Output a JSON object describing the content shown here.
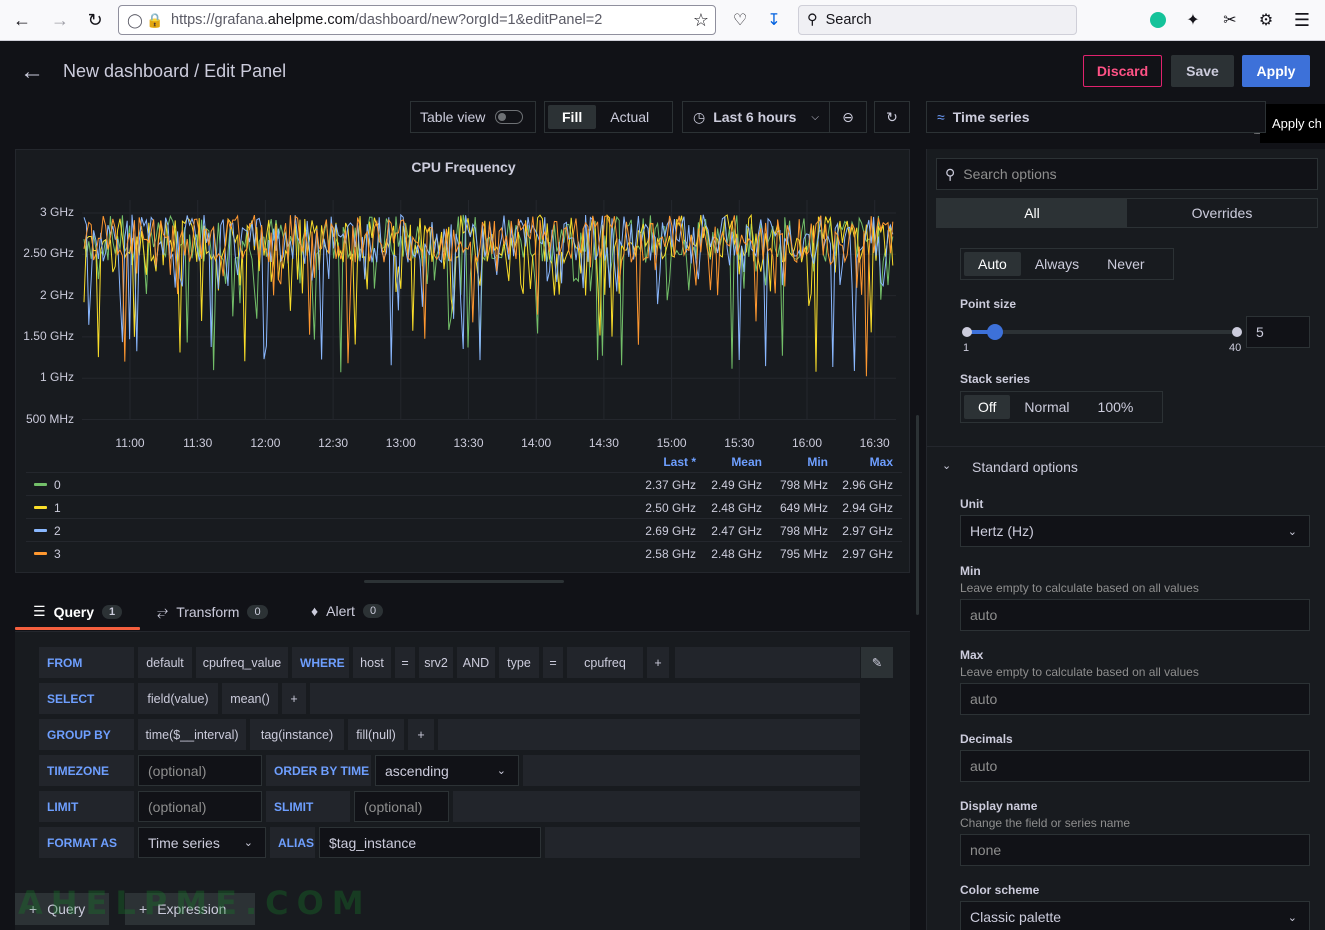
{
  "browser": {
    "url_prefix": "https://grafana.",
    "url_domain": "ahelpme.com",
    "url_rest": "/dashboard/new?orgId=1&editPanel=2",
    "search_placeholder": "Search"
  },
  "header": {
    "title": "New dashboard / Edit Panel",
    "discard": "Discard",
    "save": "Save",
    "apply": "Apply",
    "tooltip": "Apply ch"
  },
  "toolbar": {
    "table_view": "Table view",
    "fill": "Fill",
    "actual": "Actual",
    "time_range": "Last 6 hours"
  },
  "panel": {
    "title": "CPU Frequency",
    "y_ticks": [
      "3 GHz",
      "2.50 GHz",
      "2 GHz",
      "1.50 GHz",
      "1 GHz",
      "500 MHz"
    ],
    "x_ticks": [
      "11:00",
      "11:30",
      "12:00",
      "12:30",
      "13:00",
      "13:30",
      "14:00",
      "14:30",
      "15:00",
      "15:30",
      "16:00",
      "16:30"
    ],
    "legend_headers": [
      "Last *",
      "Mean",
      "Min",
      "Max"
    ],
    "legend": [
      {
        "name": "0",
        "color": "#73bf69",
        "last": "2.37 GHz",
        "mean": "2.49 GHz",
        "min": "798 MHz",
        "max": "2.96 GHz"
      },
      {
        "name": "1",
        "color": "#fade2a",
        "last": "2.50 GHz",
        "mean": "2.48 GHz",
        "min": "649 MHz",
        "max": "2.94 GHz"
      },
      {
        "name": "2",
        "color": "#8ab8ff",
        "last": "2.69 GHz",
        "mean": "2.47 GHz",
        "min": "798 MHz",
        "max": "2.97 GHz"
      },
      {
        "name": "3",
        "color": "#ff9830",
        "last": "2.58 GHz",
        "mean": "2.48 GHz",
        "min": "795 MHz",
        "max": "2.97 GHz"
      }
    ]
  },
  "query_tabs": [
    {
      "label": "Query",
      "count": "1"
    },
    {
      "label": "Transform",
      "count": "0"
    },
    {
      "label": "Alert",
      "count": "0"
    }
  ],
  "query": {
    "from": "FROM",
    "from_policy": "default",
    "from_measurement": "cpufreq_value",
    "where": "WHERE",
    "w_host": "host",
    "eq": "=",
    "w_srv": "srv2",
    "and": "AND",
    "w_type": "type",
    "w_cpufreq": "cpufreq",
    "plus": "+",
    "select": "SELECT",
    "s_field": "field(value)",
    "s_mean": "mean()",
    "group_by": "GROUP BY",
    "g_time": "time($__interval)",
    "g_tag": "tag(instance)",
    "g_fill": "fill(null)",
    "timezone": "TIMEZONE",
    "optional": "(optional)",
    "order_by": "ORDER BY TIME",
    "order_value": "ascending",
    "limit": "LIMIT",
    "slimit": "SLIMIT",
    "format_as": "FORMAT AS",
    "format_value": "Time series",
    "alias": "ALIAS",
    "alias_value": "$tag_instance",
    "add_query": "Query",
    "add_expression": "Expression"
  },
  "options": {
    "viz": "Time series",
    "search_placeholder": "Search options",
    "tab_all": "All",
    "tab_overrides": "Overrides",
    "show_points": [
      "Auto",
      "Always",
      "Never"
    ],
    "point_size_label": "Point size",
    "point_size_min": "1",
    "point_size_max": "40",
    "point_size_value": "5",
    "stack_label": "Stack series",
    "stack_options": [
      "Off",
      "Normal",
      "100%"
    ],
    "standard_options": "Standard options",
    "unit_label": "Unit",
    "unit_value": "Hertz (Hz)",
    "min_label": "Min",
    "min_desc": "Leave empty to calculate based on all values",
    "min_placeholder": "auto",
    "max_label": "Max",
    "max_desc": "Leave empty to calculate based on all values",
    "max_placeholder": "auto",
    "decimals_label": "Decimals",
    "decimals_placeholder": "auto",
    "display_name_label": "Display name",
    "display_name_desc": "Change the field or series name",
    "display_name_placeholder": "none",
    "color_scheme_label": "Color scheme",
    "color_scheme_value": "Classic palette"
  },
  "watermark": "AHELPME.COM"
}
